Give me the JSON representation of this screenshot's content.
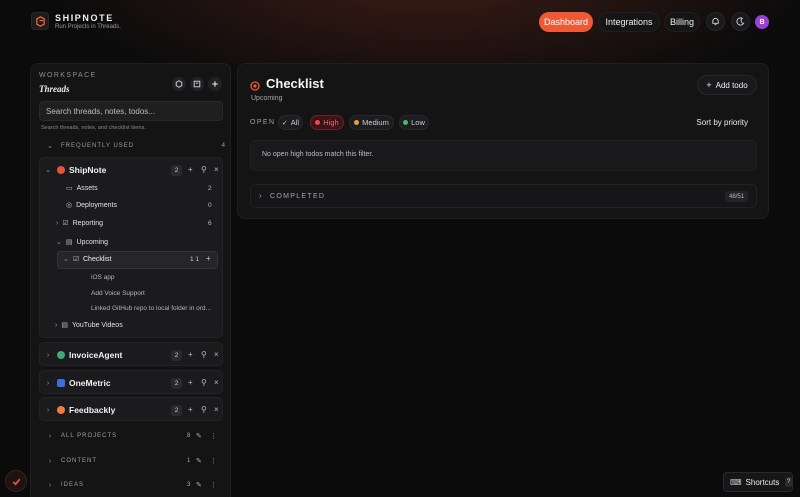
{
  "app": {
    "name": "SHIPNOTE",
    "tagline": "Run Projects in Threads."
  },
  "nav": {
    "dashboard": "Dashboard",
    "integrations": "Integrations",
    "billing": "Billing",
    "avatar_letter": "B",
    "accent": "#ee5a36"
  },
  "sidebar": {
    "workspace_label": "WORKSPACE",
    "workspace_title": "Threads",
    "search_placeholder": "Search threads, notes, todos...",
    "search_hint": "Search threads, notes, and checklist items.",
    "frequently_used": {
      "label": "FREQUENTLY USED",
      "count": "4"
    },
    "shipnote": {
      "name": "ShipNote",
      "count": "2",
      "color": "#e5533d",
      "children": [
        {
          "label": "Assets",
          "count": "2"
        },
        {
          "label": "Deployments",
          "count": "0"
        },
        {
          "label": "Reporting",
          "count": "6"
        },
        {
          "label": "Upcoming",
          "count": ""
        },
        {
          "label": "Checklist",
          "count": "1 1"
        },
        {
          "label": "YouTube Videos",
          "count": ""
        }
      ],
      "todos": [
        "iOS app",
        "Add Voice Support",
        "Linked GitHub repo to local folder in ord..."
      ]
    },
    "projects": [
      {
        "name": "InvoiceAgent",
        "count": "2",
        "color": "#3fa877"
      },
      {
        "name": "OneMetric",
        "count": "2",
        "color": "#3b6fe0"
      },
      {
        "name": "Feedbackly",
        "count": "2",
        "color": "#ef7a45"
      }
    ],
    "sections": [
      {
        "label": "ALL PROJECTS",
        "count": "8"
      },
      {
        "label": "CONTENT",
        "count": "1"
      },
      {
        "label": "IDEAS",
        "count": "3"
      }
    ]
  },
  "main": {
    "title": "Checklist",
    "subtitle": "Upcoming",
    "add_todo": "Add todo",
    "open_label": "OPEN",
    "filters": [
      {
        "label": "All",
        "color": ""
      },
      {
        "label": "High",
        "color": "#f04848"
      },
      {
        "label": "Medium",
        "color": "#e8a23a"
      },
      {
        "label": "Low",
        "color": "#3fbf6a"
      }
    ],
    "sort": "Sort by priority",
    "empty_message": "No open high todos match this filter.",
    "completed_label": "COMPLETED",
    "completed_count": "48/51"
  },
  "footer": {
    "shortcuts": "Shortcuts",
    "shortcuts_key": "?"
  }
}
